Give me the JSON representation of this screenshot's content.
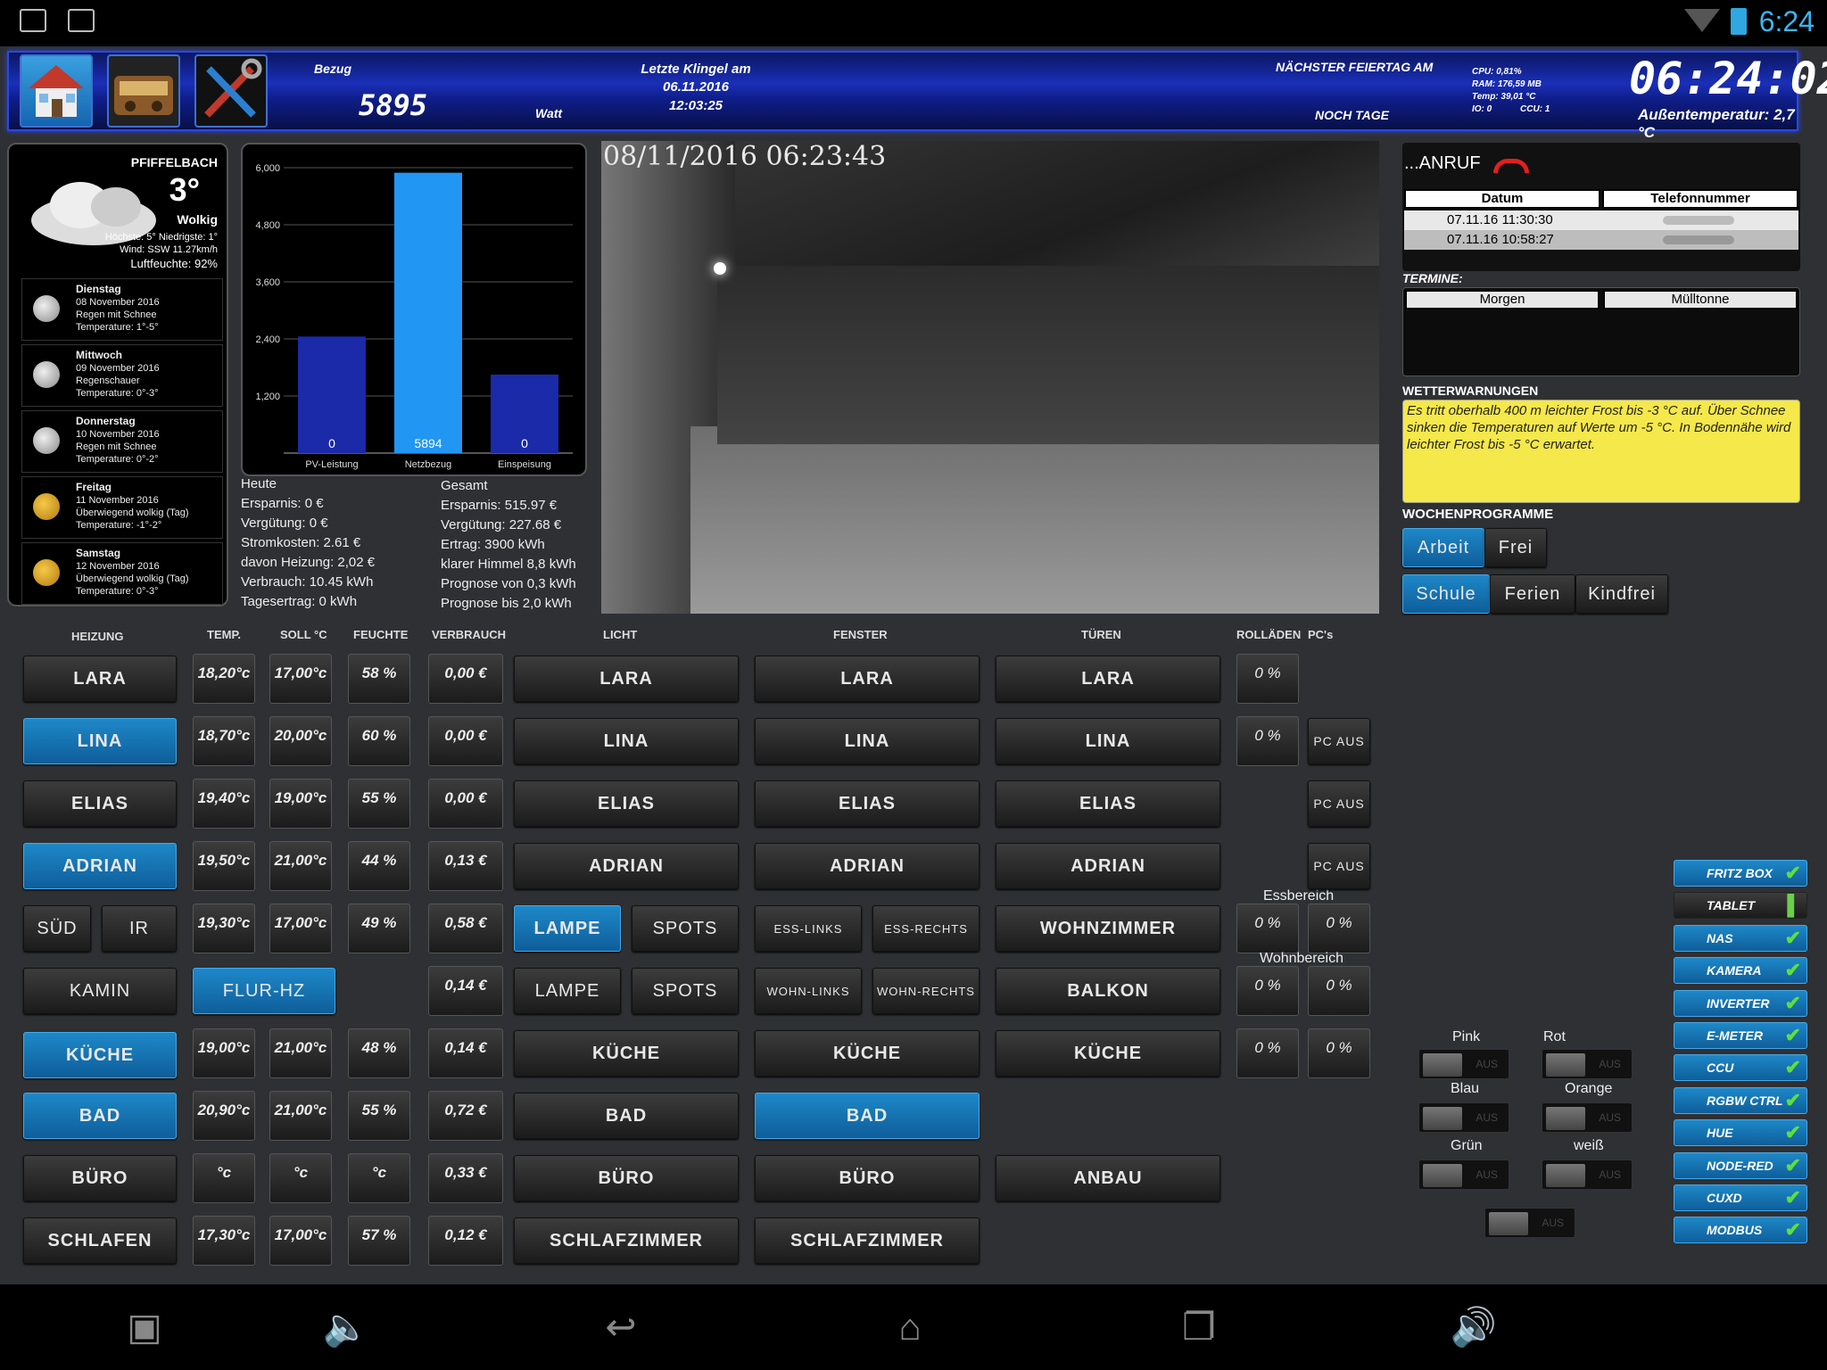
{
  "status_bar": {
    "time": "6:24"
  },
  "header": {
    "bezug_label": "Bezug",
    "bezug_value": "5895",
    "watt_label": "Watt",
    "klingel_title": "Letzte Klingel am",
    "klingel_date": "06.11.2016",
    "klingel_time": "12:03:25",
    "feiertag_title": "Nächster Feiertag am",
    "feiertag_noch": "noch Tage",
    "sys_cpu": "CPU: 0,81%",
    "sys_ram": "RAM: 176,59 MB",
    "sys_temp": "Temp: 39,01 °C",
    "sys_io": "IO: 0",
    "sys_ccu": "CCU: 1",
    "clock": "06:24:02",
    "outside_temp": "Außentemperatur: 2,7 °C"
  },
  "weather": {
    "location": "PFIFFELBACH",
    "temp": "3°",
    "condition": "Wolkig",
    "details1": "Höchste: 5° Niedrigste: 1°",
    "details2": "Wind: SSW 11.27km/h",
    "humidity": "Luftfeuchte: 92%",
    "forecast": [
      {
        "day": "Dienstag",
        "date": "08 November 2016",
        "desc": "Regen mit Schnee",
        "temp": "Temperature: 1°-5°",
        "icon": "rain-snow-icon"
      },
      {
        "day": "Mittwoch",
        "date": "09 November 2016",
        "desc": "Regenschauer",
        "temp": "Temperature: 0°-3°",
        "icon": "rain-icon"
      },
      {
        "day": "Donnerstag",
        "date": "10 November 2016",
        "desc": "Regen mit Schnee",
        "temp": "Temperature: 0°-2°",
        "icon": "rain-snow-icon"
      },
      {
        "day": "Freitag",
        "date": "11 November 2016",
        "desc": "Überwiegend wolkig (Tag)",
        "temp": "Temperature: -1°-2°",
        "icon": "partly-cloudy-icon"
      },
      {
        "day": "Samstag",
        "date": "12 November 2016",
        "desc": "Überwiegend wolkig (Tag)",
        "temp": "Temperature: 0°-3°",
        "icon": "partly-cloudy-icon"
      }
    ]
  },
  "chart_data": {
    "type": "bar",
    "categories": [
      "PV-Leistung",
      "Netzbezug",
      "Einspeisung"
    ],
    "values": [
      2450,
      5894,
      1650
    ],
    "value_labels": [
      "0",
      "5894",
      "0"
    ],
    "colors": [
      "#1a2aa8",
      "#2196f3",
      "#1a2aa8"
    ],
    "ylim": [
      0,
      6000
    ],
    "yticks": [
      "1,200",
      "2,400",
      "3,600",
      "4,800",
      "6,000"
    ],
    "ytick_values": [
      1200,
      2400,
      3600,
      4800,
      6000
    ],
    "grid": true
  },
  "energy": {
    "heute": [
      "Heute",
      "Ersparnis: 0 €",
      "Vergütung: 0 €",
      "Stromkosten: 2.61 €",
      "davon Heizung: 2,02 €",
      "Verbrauch: 10.45 kWh",
      "Tagesertrag: 0 kWh"
    ],
    "gesamt": [
      "Gesamt",
      "Ersparnis: 515.97 €",
      "Vergütung: 227.68 €",
      "Ertrag: 3900 kWh",
      "klarer Himmel 8,8 kWh",
      "Prognose von 0,3 kWh",
      "Prognose bis 2,0 kWh"
    ]
  },
  "camera": {
    "timestamp": "08/11/2016 06:23:43"
  },
  "calls": {
    "title": "...ANRUF",
    "col_date": "Datum",
    "col_phone": "Telefonnummer",
    "rows": [
      {
        "date": "07.11.16 11:30:30"
      },
      {
        "date": "07.11.16 10:58:27"
      }
    ]
  },
  "termine": {
    "title": "TERMINE:",
    "when": "Morgen",
    "what": "Mülltonne"
  },
  "warnings": {
    "title": "WETTERWARNUNGEN",
    "text": "Es tritt oberhalb 400 m leichter Frost bis -3 °C auf. Über Schnee sinken die Temperaturen auf Werte um -5 °C. In Bodennähe wird leichter Frost bis -5 °C erwartet."
  },
  "wochenprogramme": {
    "title": "WOCHENPROGRAMME",
    "row1": [
      "Arbeit",
      "Frei"
    ],
    "row2": [
      "Schule",
      "Ferien",
      "Kindfrei"
    ]
  },
  "columns": {
    "heizung": "HEIZUNG",
    "temp": "TEMP.",
    "soll": "SOLL °C",
    "feuchte": "FEUCHTE",
    "verbrauch": "VERBRAUCH",
    "licht": "LICHT",
    "fenster": "FENSTER",
    "tueren": "TÜREN",
    "rollaeden": "ROLLÄDEN",
    "pcs": "PC's"
  },
  "heizung": [
    "LARA",
    "LINA",
    "ELIAS",
    "ADRIAN",
    "SÜD",
    "IR",
    "KAMIN",
    "KÜCHE",
    "BAD",
    "BÜRO",
    "SCHLAFEN",
    "FLUR-HZ"
  ],
  "temps": [
    "18,20°c",
    "18,70°c",
    "19,40°c",
    "19,50°c",
    "19,30°c",
    "19,00°c",
    "20,90°c",
    "°c",
    "17,30°c"
  ],
  "solls": [
    "17,00°c",
    "20,00°c",
    "19,00°c",
    "21,00°c",
    "17,00°c",
    "21,00°c",
    "21,00°c",
    "°c",
    "17,00°c"
  ],
  "feuchte": [
    "58 %",
    "60 %",
    "55 %",
    "44 %",
    "49 %",
    "48 %",
    "55 %",
    "°c",
    "57 %"
  ],
  "verbrauch": [
    "0,00 €",
    "0,00 €",
    "0,00 €",
    "0,13 €",
    "0,58 €",
    "0,14 €",
    "0,72 €",
    "0,33 €",
    "0,12 €"
  ],
  "licht": [
    "LARA",
    "LINA",
    "ELIAS",
    "ADRIAN",
    "LAMPE",
    "SPOTS",
    "LAMPE",
    "SPOTS",
    "KÜCHE",
    "BAD",
    "BÜRO",
    "SCHLAFZIMMER"
  ],
  "fenster": [
    "LARA",
    "LINA",
    "ELIAS",
    "ADRIAN",
    "ESS-LINKS",
    "ESS-RECHTS",
    "WOHN-LINKS",
    "WOHN-RECHTS",
    "KÜCHE",
    "BAD",
    "BÜRO",
    "SCHLAFZIMMER"
  ],
  "tueren": [
    "LARA",
    "LINA",
    "ELIAS",
    "ADRIAN",
    "WOHNZIMMER",
    "BALKON",
    "KÜCHE",
    "ANBAU"
  ],
  "rollaeden": {
    "lara": "0 %",
    "lina": "0 %",
    "essbereich": "Essbereich",
    "ess1": "0 %",
    "ess2": "0 %",
    "wohnbereich": "Wohnbereich",
    "wohn1": "0 %",
    "wohn2": "0 %",
    "kueche1": "0 %",
    "kueche2": "0 %"
  },
  "pcs": [
    "PC AUS",
    "PC AUS",
    "PC AUS"
  ],
  "rgbw": {
    "labels": [
      "Pink",
      "Rot",
      "Blau",
      "Orange",
      "Grün",
      "weiß"
    ],
    "state": "AUS"
  },
  "devices": [
    "FRITZ BOX",
    "TABLET",
    "NAS",
    "KAMERA",
    "INVERTER",
    "E-METER",
    "CCU",
    "RGBW CTRL",
    "HUE",
    "NODE-RED",
    "CUXD",
    "MODBUS"
  ]
}
